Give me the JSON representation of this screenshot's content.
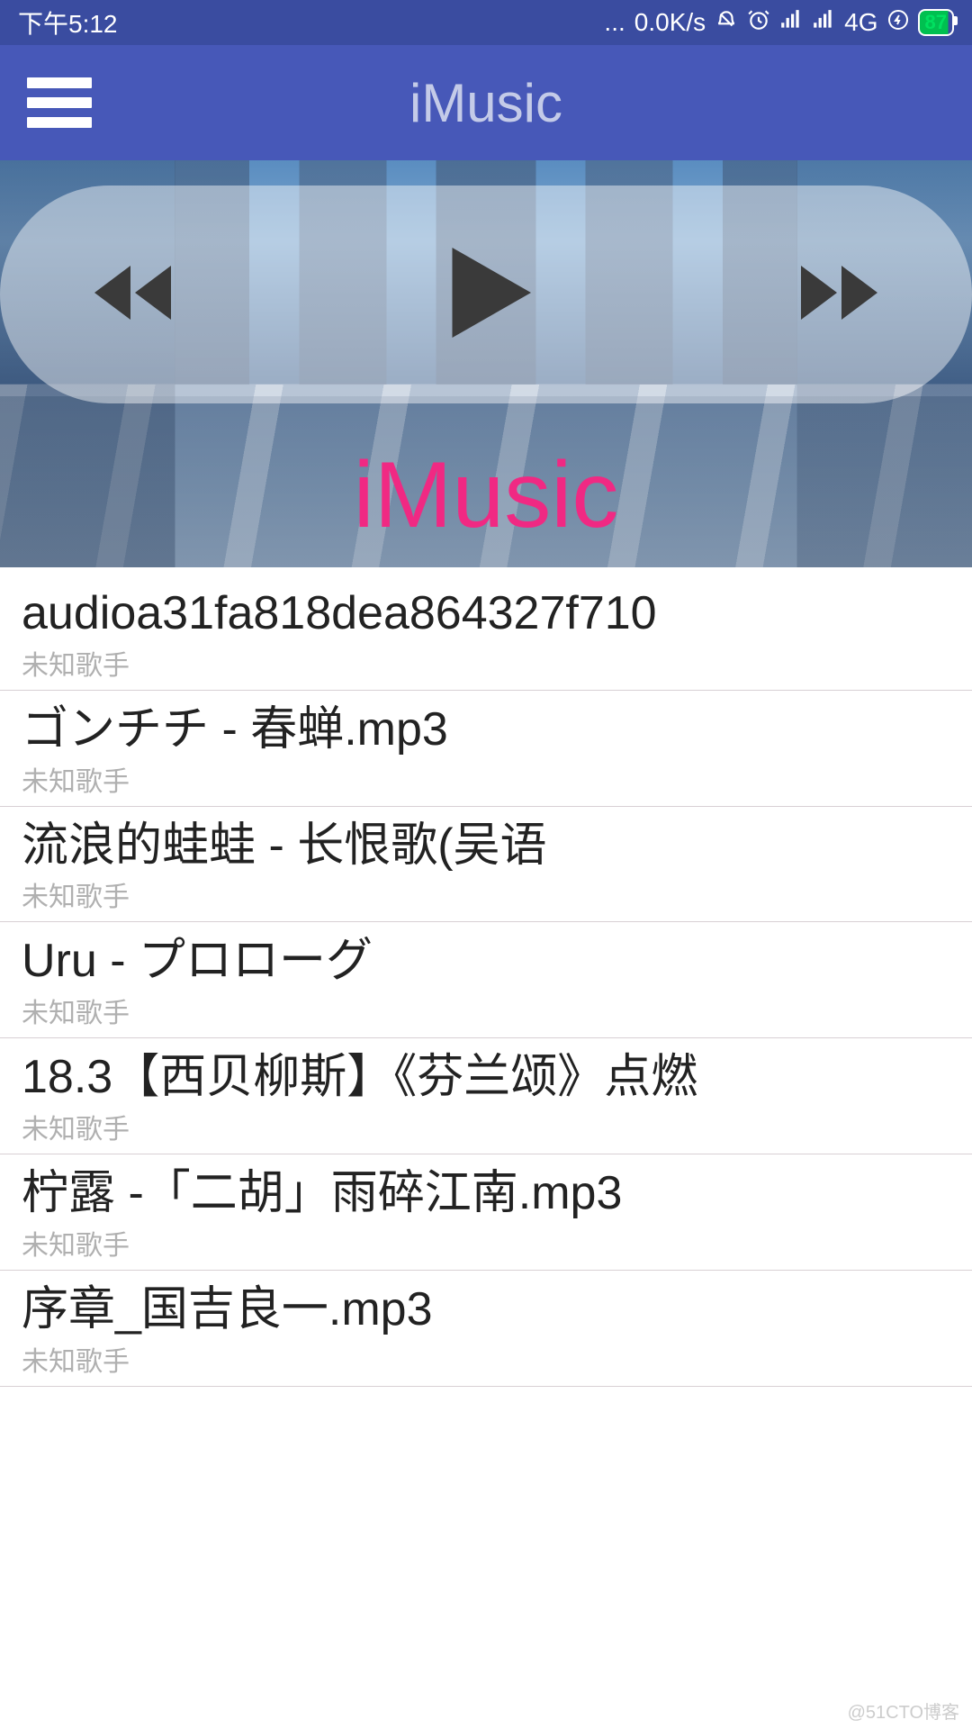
{
  "status": {
    "time": "下午5:12",
    "dots": "...",
    "speed": "0.0K/s",
    "network": "4G",
    "battery": "87"
  },
  "appbar": {
    "title": "iMusic"
  },
  "hero": {
    "brand": "iMusic"
  },
  "songs": [
    {
      "title": "audioa31fa818dea864327f710",
      "artist": "未知歌手"
    },
    {
      "title": "ゴンチチ - 春蝉.mp3",
      "artist": "未知歌手"
    },
    {
      "title": "流浪的蛙蛙 - 长恨歌(吴语",
      "artist": "未知歌手"
    },
    {
      "title": "Uru - プロローグ",
      "artist": "未知歌手"
    },
    {
      "title": "18.3【西贝柳斯】《芬兰颂》点燃",
      "artist": "未知歌手"
    },
    {
      "title": "柠露 -「二胡」雨碎江南.mp3",
      "artist": "未知歌手"
    },
    {
      "title": "序章_国吉良一.mp3",
      "artist": "未知歌手"
    }
  ],
  "watermark": "@51CTO博客"
}
